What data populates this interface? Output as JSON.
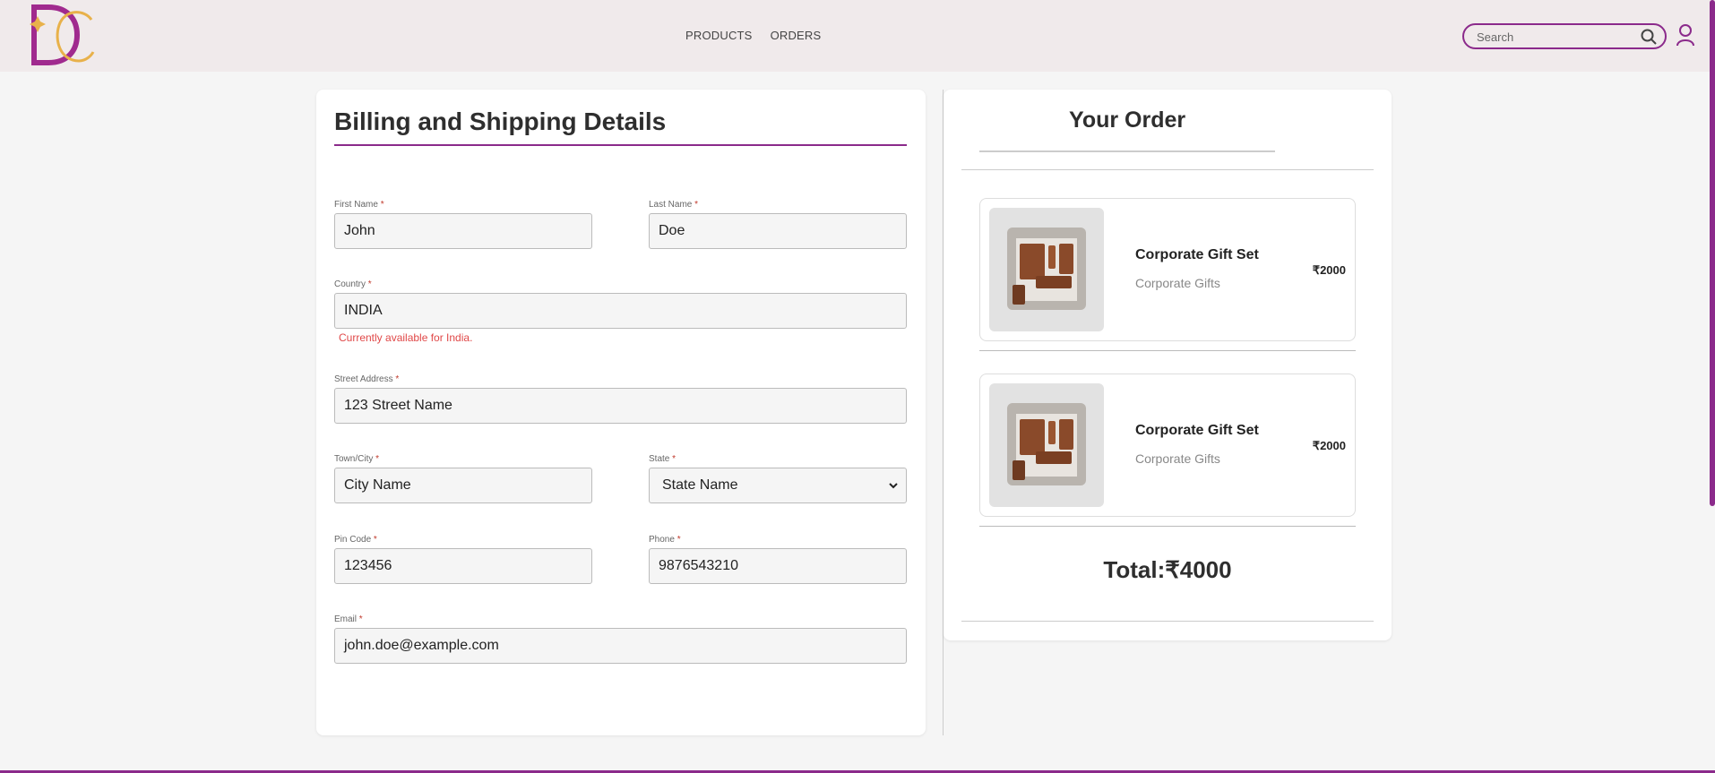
{
  "brand": {
    "logo_text": "DC",
    "primary_color": "#8b2a8b",
    "accent_gold": "#e8b14a"
  },
  "header": {
    "nav": [
      {
        "label": "PRODUCTS"
      },
      {
        "label": "ORDERS"
      }
    ],
    "search": {
      "placeholder": "Search",
      "value": ""
    },
    "icons": {
      "search": "search-icon",
      "user": "user-icon"
    }
  },
  "billing": {
    "title": "Billing and Shipping Details",
    "fields": {
      "first_name": {
        "label": "First Name",
        "required": "*",
        "value": "John"
      },
      "last_name": {
        "label": "Last Name",
        "required": "*",
        "value": "Doe"
      },
      "country": {
        "label": "Country",
        "required": "*",
        "value": "INDIA",
        "note": "Currently available for India."
      },
      "street": {
        "label": "Street Address",
        "required": "*",
        "value": "123 Street Name"
      },
      "city": {
        "label": "Town/City",
        "required": "*",
        "value": "City Name"
      },
      "state": {
        "label": "State",
        "required": "*",
        "value": "State Name"
      },
      "pin": {
        "label": "Pin Code",
        "required": "*",
        "value": "123456"
      },
      "phone": {
        "label": "Phone",
        "required": "*",
        "value": "9876543210"
      },
      "email": {
        "label": "Email",
        "required": "*",
        "value": "john.doe@example.com"
      }
    }
  },
  "order": {
    "title": "Your Order",
    "items": [
      {
        "name": "Corporate Gift Set",
        "category": "Corporate Gifts",
        "price": "₹2000"
      },
      {
        "name": "Corporate Gift Set",
        "category": "Corporate Gifts",
        "price": "₹2000"
      }
    ],
    "total_label": "Total:₹4000"
  }
}
